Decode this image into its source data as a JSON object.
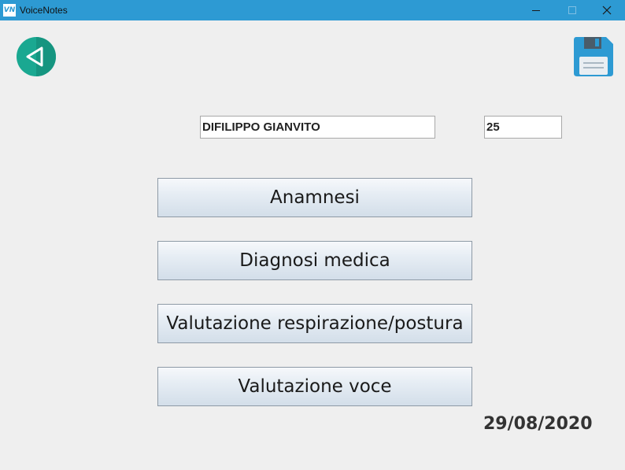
{
  "window": {
    "title": "VoiceNotes",
    "app_icon_text": "VN"
  },
  "toolbar": {
    "back_icon": "back-arrow-icon",
    "save_icon": "floppy-disk-icon",
    "accent_color": "#1aa891",
    "save_color": "#2d9ad3"
  },
  "patient": {
    "name": "DIFILIPPO GIANVITO",
    "age": "25"
  },
  "menu": {
    "anamnesi": "Anamnesi",
    "diagnosi": "Diagnosi medica",
    "respirazione": "Valutazione respirazione/postura",
    "voce": "Valutazione voce"
  },
  "date": "29/08/2020"
}
